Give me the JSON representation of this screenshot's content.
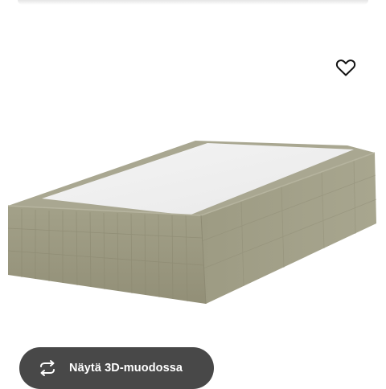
{
  "product": {
    "image_icon": "bed-base-image",
    "fabric_color": "#9b9a82"
  },
  "favorite": {
    "icon": "heart-outline-icon"
  },
  "view3d": {
    "icon": "rotate-3d-icon",
    "label": "Näytä 3D-muodossa"
  }
}
